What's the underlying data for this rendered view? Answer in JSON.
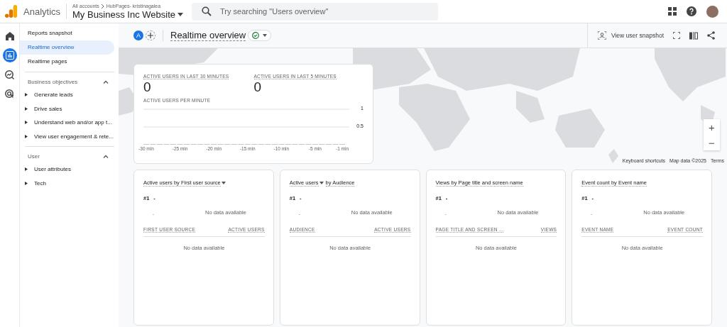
{
  "header": {
    "product": "Analytics",
    "breadcrumb": [
      "All accounts",
      "HubPages- kristinagalea"
    ],
    "property": "My Business Inc Website",
    "search": {
      "placeholder": "Try searching \"Users overview\""
    }
  },
  "rail": [
    {
      "selected": false
    },
    {
      "selected": true
    },
    {
      "selected": false
    },
    {
      "selected": false
    }
  ],
  "sidebar": {
    "top_items": [
      {
        "label": "Reports snapshot",
        "selected": false
      },
      {
        "label": "Realtime overview",
        "selected": true
      },
      {
        "label": "Realtime pages",
        "selected": false
      }
    ],
    "sections": [
      {
        "title": "Business objectives",
        "expanded": true,
        "items": [
          {
            "label": "Generate leads",
            "expanded": false
          },
          {
            "label": "Drive sales",
            "expanded": false
          },
          {
            "label": "Understand web and/or app t...",
            "expanded": false
          },
          {
            "label": "View user engagement & rete...",
            "expanded": false
          }
        ]
      },
      {
        "title": "User",
        "expanded": true,
        "items": [
          {
            "label": "User attributes",
            "expanded": false
          },
          {
            "label": "Tech",
            "expanded": false
          }
        ]
      }
    ]
  },
  "toolbar": {
    "comparison_letter": "A",
    "title": "Realtime overview",
    "actions": [
      "View user snapshot"
    ]
  },
  "map": {
    "zoom": [
      "+",
      "−"
    ],
    "attribution": [
      "Keyboard shortcuts",
      "Map data ©2025",
      "Terms"
    ]
  },
  "realtime": {
    "metrics": [
      {
        "label": "ACTIVE USERS IN LAST 30 MINUTES",
        "value": "0"
      },
      {
        "label": "ACTIVE USERS IN LAST 5 MINUTES",
        "value": "0"
      }
    ],
    "chart_label": "ACTIVE USERS PER MINUTE",
    "chart_data": {
      "type": "bar",
      "x": [
        -30,
        -29,
        -28,
        -27,
        -26,
        -25,
        -24,
        -23,
        -22,
        -21,
        -20,
        -19,
        -18,
        -17,
        -16,
        -15,
        -14,
        -13,
        -12,
        -11,
        -10,
        -9,
        -8,
        -7,
        -6,
        -5,
        -4,
        -3,
        -2,
        -1
      ],
      "values": [
        0,
        0,
        0,
        0,
        0,
        0,
        0,
        0,
        0,
        0,
        0,
        0,
        0,
        0,
        0,
        0,
        0,
        0,
        0,
        0,
        0,
        0,
        0,
        0,
        0,
        0,
        0,
        0,
        0,
        0
      ],
      "xlim": [
        -30,
        -1
      ],
      "ylim": [
        0,
        1
      ],
      "yticks": [
        0.5,
        1
      ],
      "xticks": [
        {
          "value": -30,
          "label": "-30 min"
        },
        {
          "value": -25,
          "label": "-25 min"
        },
        {
          "value": -20,
          "label": "-20 min"
        },
        {
          "value": -15,
          "label": "-15 min"
        },
        {
          "value": -10,
          "label": "-10 min"
        },
        {
          "value": -5,
          "label": "-5 min"
        },
        {
          "value": -1,
          "label": "-1 min"
        }
      ]
    }
  },
  "cards": [
    {
      "title_parts": [
        {
          "text": "Active users by First user source",
          "dropdown": true
        }
      ],
      "rank": "#1",
      "rank_value": "-",
      "axis_mark": "-",
      "chart_empty": "No data available",
      "columns": [
        "FIRST USER SOURCE",
        "ACTIVE USERS"
      ],
      "table_empty": "No data available"
    },
    {
      "title_parts": [
        {
          "text": "Active users",
          "dropdown": true
        },
        {
          "text": "by Audience"
        }
      ],
      "rank": "#1",
      "rank_value": "-",
      "axis_mark": "-",
      "chart_empty": "No data available",
      "columns": [
        "AUDIENCE",
        "ACTIVE USERS"
      ],
      "table_empty": "No data available"
    },
    {
      "title_parts": [
        {
          "text": "Views by Page title and screen name"
        }
      ],
      "rank": "#1",
      "rank_value": "-",
      "axis_mark": "-",
      "chart_empty": "No data available",
      "columns": [
        "PAGE TITLE AND SCREEN ...",
        "VIEWS"
      ],
      "table_empty": "No data available"
    },
    {
      "title_parts": [
        {
          "text": "Event count by Event name"
        }
      ],
      "rank": "#1",
      "rank_value": "-",
      "axis_mark": "-",
      "chart_empty": "No data available",
      "columns": [
        "EVENT NAME",
        "EVENT COUNT"
      ],
      "table_empty": "No data available"
    }
  ]
}
